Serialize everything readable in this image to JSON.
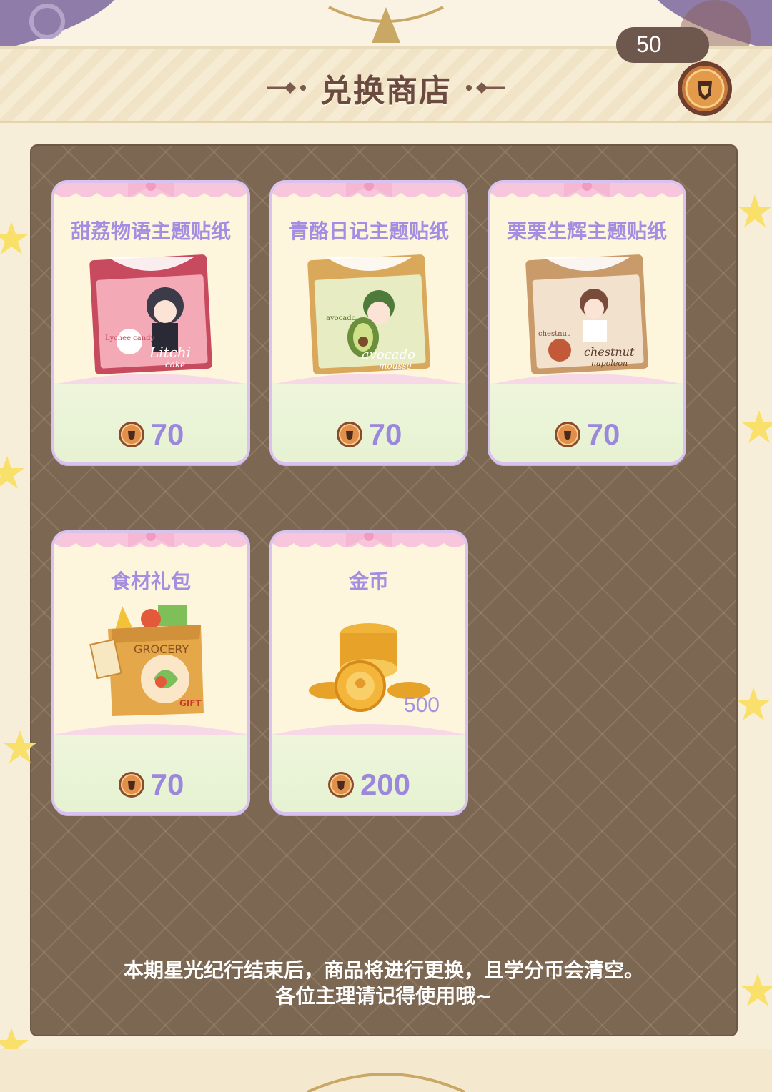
{
  "header": {
    "title": "兑换商店",
    "currency_amount": "50",
    "currency_icon": "medal-coin-icon"
  },
  "items": [
    {
      "name": "甜荔物语主题贴纸",
      "price": "70",
      "image": "litchi-cake-sticker-icon"
    },
    {
      "name": "青酪日记主题贴纸",
      "price": "70",
      "image": "avocado-mousse-sticker-icon"
    },
    {
      "name": "栗栗生辉主题贴纸",
      "price": "70",
      "image": "chestnut-napoleon-sticker-icon"
    },
    {
      "name": "食材礼包",
      "price": "70",
      "image": "grocery-bag-icon"
    },
    {
      "name": "金币",
      "price": "200",
      "quantity": "500",
      "image": "gold-coins-icon"
    }
  ],
  "sticker_texts": {
    "litchi_top": "Lychee candy",
    "litchi": "Litchi",
    "litchi_cake": "cake",
    "avocado_top": "avocado",
    "avocado": "avocado",
    "avocado_mousse": "mousse",
    "chestnut_top": "chestnut",
    "chestnut": "chestnut",
    "chestnut_napoleon": "napoleon",
    "grocery": "GROCERY",
    "gift": "GIFT"
  },
  "notice": {
    "line1": "本期星光纪行结束后，商品将进行更换，且学分币会清空。",
    "line2": "各位主理请记得使用哦~"
  },
  "colors": {
    "panel": "#7c6753",
    "card": "#fdf6dc",
    "price": "#9b88dc",
    "title": "#6b4a3f",
    "frame": "#f7eed9"
  }
}
